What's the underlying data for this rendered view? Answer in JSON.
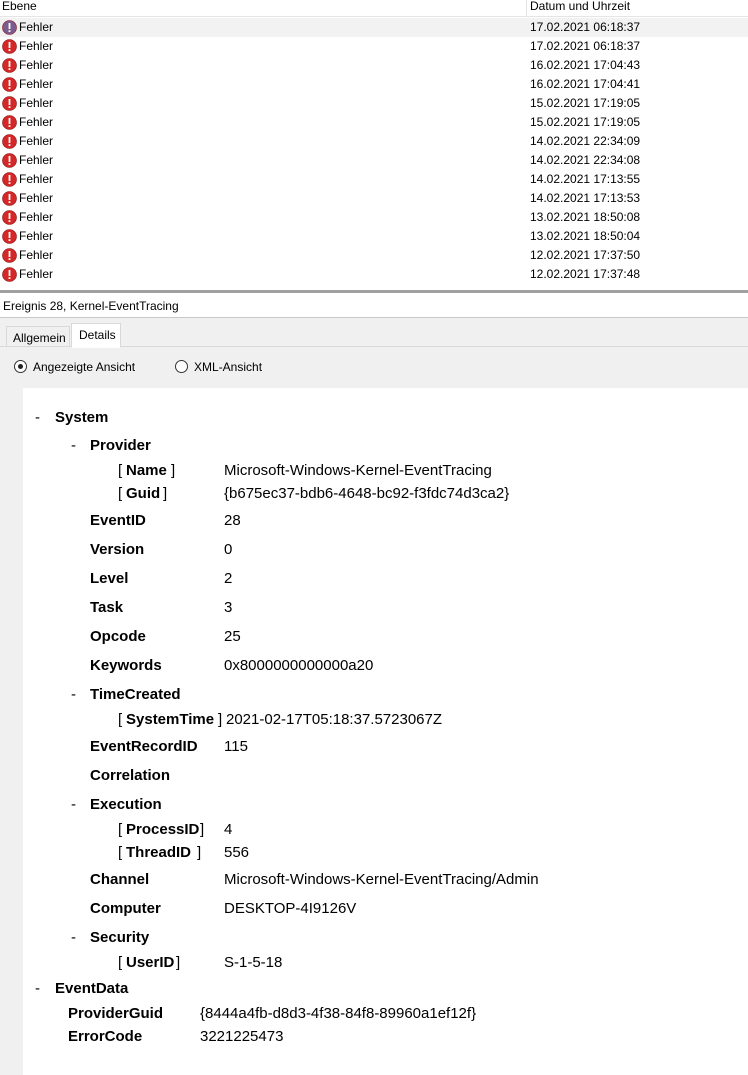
{
  "list": {
    "columns": {
      "level": "Ebene",
      "datetime": "Datum und Uhrzeit"
    },
    "rows": [
      {
        "level": "Fehler",
        "datetime": "17.02.2021 06:18:37"
      },
      {
        "level": "Fehler",
        "datetime": "17.02.2021 06:18:37"
      },
      {
        "level": "Fehler",
        "datetime": "16.02.2021 17:04:43"
      },
      {
        "level": "Fehler",
        "datetime": "16.02.2021 17:04:41"
      },
      {
        "level": "Fehler",
        "datetime": "15.02.2021 17:19:05"
      },
      {
        "level": "Fehler",
        "datetime": "15.02.2021 17:19:05"
      },
      {
        "level": "Fehler",
        "datetime": "14.02.2021 22:34:09"
      },
      {
        "level": "Fehler",
        "datetime": "14.02.2021 22:34:08"
      },
      {
        "level": "Fehler",
        "datetime": "14.02.2021 17:13:55"
      },
      {
        "level": "Fehler",
        "datetime": "14.02.2021 17:13:53"
      },
      {
        "level": "Fehler",
        "datetime": "13.02.2021 18:50:08"
      },
      {
        "level": "Fehler",
        "datetime": "13.02.2021 18:50:04"
      },
      {
        "level": "Fehler",
        "datetime": "12.02.2021 17:37:50"
      },
      {
        "level": "Fehler",
        "datetime": "12.02.2021 17:37:48"
      }
    ],
    "error_icon": "error-icon"
  },
  "event_title": "Ereignis 28, Kernel-EventTracing",
  "tabs": {
    "general": "Allgemein",
    "details": "Details"
  },
  "view": {
    "friendly": "Angezeigte Ansicht",
    "xml": "XML-Ansicht",
    "selected": "friendly"
  },
  "details": {
    "collapse_glyph": "-",
    "system": "System",
    "provider": "Provider",
    "provider_name_key": "Name",
    "provider_name_val": "Microsoft-Windows-Kernel-EventTracing",
    "provider_guid_key": "Guid",
    "provider_guid_val": "{b675ec37-bdb6-4648-bc92-f3fdc74d3ca2}",
    "event_id_key": "EventID",
    "event_id_val": "28",
    "version_key": "Version",
    "version_val": "0",
    "level_key": "Level",
    "level_val": "2",
    "task_key": "Task",
    "task_val": "3",
    "opcode_key": "Opcode",
    "opcode_val": "25",
    "keywords_key": "Keywords",
    "keywords_val": "0x8000000000000a20",
    "time_created": "TimeCreated",
    "system_time_key": "SystemTime",
    "system_time_val": "2021-02-17T05:18:37.5723067Z",
    "record_id_key": "EventRecordID",
    "record_id_val": "115",
    "correlation": "Correlation",
    "execution": "Execution",
    "process_id_key": "ProcessID",
    "process_id_val": "4",
    "thread_id_key": "ThreadID",
    "thread_id_val": "556",
    "channel_key": "Channel",
    "channel_val": "Microsoft-Windows-Kernel-EventTracing/Admin",
    "computer_key": "Computer",
    "computer_val": "DESKTOP-4I9126V",
    "security": "Security",
    "user_id_key": "UserID",
    "user_id_val": "S-1-5-18",
    "event_data": "EventData",
    "provider_guid2_key": "ProviderGuid",
    "provider_guid2_val": "{8444a4fb-d8d3-4f38-84f8-89960a1ef12f}",
    "error_code_key": "ErrorCode",
    "error_code_val": "3221225473",
    "bracket_open": "[",
    "bracket_close": "]"
  }
}
